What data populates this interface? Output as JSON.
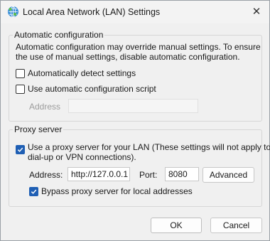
{
  "window": {
    "title": "Local Area Network (LAN) Settings",
    "icon": "network-globe-icon",
    "close_glyph": "✕"
  },
  "auto_config": {
    "legend": "Automatic configuration",
    "description": "Automatic configuration may override manual settings.  To ensure the use of manual settings, disable automatic configuration.",
    "detect": {
      "label": "Automatically detect settings",
      "checked": false
    },
    "script": {
      "label": "Use automatic configuration script",
      "checked": false
    },
    "address_label": "Address",
    "address_value": ""
  },
  "proxy": {
    "legend": "Proxy server",
    "use_proxy": {
      "label_line1": "Use a proxy server for your LAN (These settings will not apply to",
      "label_line2": "dial-up or VPN connections).",
      "checked": true
    },
    "address_label": "Address:",
    "address_value": "http://127.0.0.1",
    "port_label": "Port:",
    "port_value": "8080",
    "advanced_label": "Advanced",
    "bypass": {
      "label": "Bypass proxy server for local addresses",
      "checked": true
    }
  },
  "buttons": {
    "ok": "OK",
    "cancel": "Cancel"
  },
  "colors": {
    "checkbox_checked": "#1f5fb4",
    "window_bg": "#f0f0f0"
  }
}
